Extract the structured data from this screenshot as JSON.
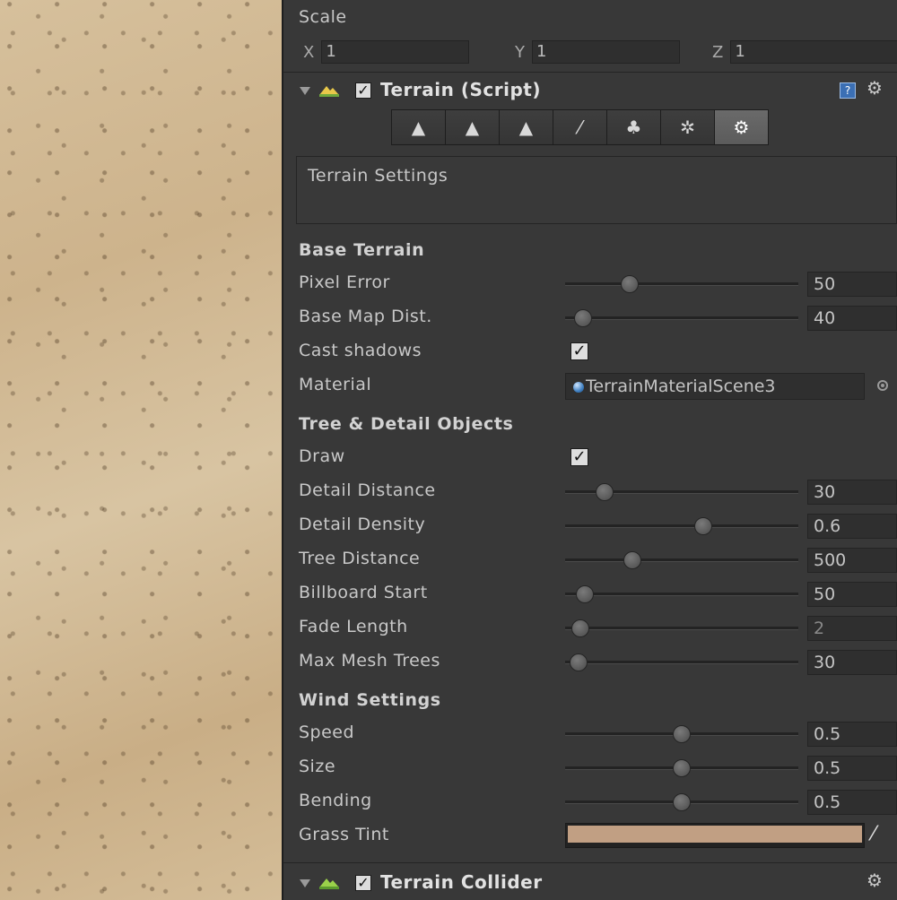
{
  "transform": {
    "scale_label": "Scale",
    "x_label": "X",
    "x_value": "1",
    "y_label": "Y",
    "y_value": "1",
    "z_label": "Z",
    "z_value": "1"
  },
  "terrain_component": {
    "title": "Terrain (Script)",
    "enabled": "✓",
    "help_glyph": "?",
    "gear_glyph": "⚙",
    "tools": [
      {
        "name": "raise-lower-terrain",
        "glyph": "▲"
      },
      {
        "name": "paint-height",
        "glyph": "▲"
      },
      {
        "name": "smooth-height",
        "glyph": "▲"
      },
      {
        "name": "paint-texture",
        "glyph": "⁄"
      },
      {
        "name": "place-trees",
        "glyph": "♣"
      },
      {
        "name": "paint-details",
        "glyph": "✲"
      },
      {
        "name": "terrain-settings",
        "glyph": "⚙",
        "active": true
      }
    ],
    "info_text": "Terrain Settings"
  },
  "base_terrain": {
    "header": "Base Terrain",
    "pixel_error": {
      "label": "Pixel Error",
      "value": "50",
      "fraction": 0.26
    },
    "base_map_dist": {
      "label": "Base Map Dist.",
      "value": "40",
      "fraction": 0.04
    },
    "cast_shadows": {
      "label": "Cast shadows",
      "check": "✓"
    },
    "material": {
      "label": "Material",
      "value": "TerrainMaterialScene3"
    }
  },
  "tree_detail": {
    "header": "Tree & Detail Objects",
    "draw": {
      "label": "Draw",
      "check": "✓"
    },
    "detail_distance": {
      "label": "Detail Distance",
      "value": "30",
      "fraction": 0.14
    },
    "detail_density": {
      "label": "Detail Density",
      "value": "0.6",
      "fraction": 0.6
    },
    "tree_distance": {
      "label": "Tree Distance",
      "value": "500",
      "fraction": 0.27
    },
    "billboard_start": {
      "label": "Billboard Start",
      "value": "50",
      "fraction": 0.05
    },
    "fade_length": {
      "label": "Fade Length",
      "value": "2",
      "fraction": 0.03
    },
    "max_mesh_trees": {
      "label": "Max Mesh Trees",
      "value": "30",
      "fraction": 0.02
    }
  },
  "wind": {
    "header": "Wind Settings",
    "speed": {
      "label": "Speed",
      "value": "0.5",
      "fraction": 0.5
    },
    "size": {
      "label": "Size",
      "value": "0.5",
      "fraction": 0.5
    },
    "bending": {
      "label": "Bending",
      "value": "0.5",
      "fraction": 0.5
    },
    "grass_tint": {
      "label": "Grass Tint",
      "color": "#c19f83"
    }
  },
  "terrain_collider": {
    "title": "Terrain Collider",
    "enabled": "✓",
    "gear_glyph": "⚙"
  }
}
